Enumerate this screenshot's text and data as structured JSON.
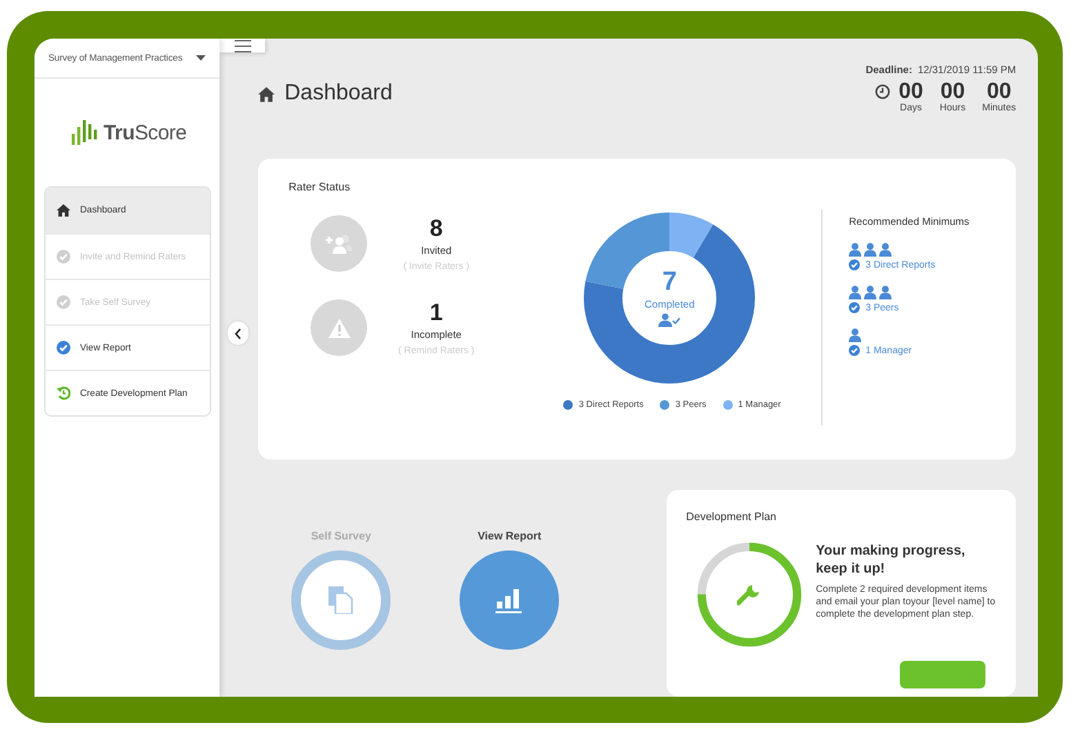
{
  "survey_selector": {
    "label": "Survey of Management Practices"
  },
  "logo": {
    "text": "**Tru**Score"
  },
  "sidebar": {
    "items": [
      {
        "label": "Dashboard",
        "kind": "home",
        "selected": true,
        "disabled": false
      },
      {
        "label": "Invite and Remind Raters",
        "kind": "check",
        "selected": false,
        "disabled": true
      },
      {
        "label": "Take Self Survey",
        "kind": "check",
        "selected": false,
        "disabled": true
      },
      {
        "label": "View Report",
        "kind": "check",
        "selected": false,
        "disabled": false
      },
      {
        "label": "Create Development Plan",
        "kind": "plan",
        "selected": false,
        "disabled": false
      }
    ]
  },
  "page": {
    "title": "Dashboard"
  },
  "deadline": {
    "label": "Deadline:",
    "value": "12/31/2019 11:59 PM",
    "units": [
      {
        "value": "00",
        "label": "Days"
      },
      {
        "value": "00",
        "label": "Hours"
      },
      {
        "value": "00",
        "label": "Minutes"
      }
    ]
  },
  "rater_status": {
    "title": "Rater Status",
    "stats": [
      {
        "kind": "invite",
        "count": "8",
        "label": "Invited",
        "link": "( Invite Raters )",
        "disabled": true
      },
      {
        "kind": "warning",
        "count": "1",
        "label": "Incomplete",
        "link": "( Remind Raters )",
        "disabled": true
      }
    ],
    "completed": {
      "count": "7",
      "label": "Completed"
    },
    "legend": [
      {
        "label": "3 Direct Reports",
        "color": "#3c78c6"
      },
      {
        "label": "3 Peers",
        "color": "#5596d6"
      },
      {
        "label": "1 Manager",
        "color": "#7eb2f2"
      }
    ],
    "recommended": {
      "title": "Recommended Minimums",
      "groups": [
        {
          "kind": "direct_reports",
          "label": "3 Direct Reports"
        },
        {
          "kind": "peers",
          "label": "3 Peers"
        },
        {
          "kind": "manager",
          "label": "1 Manager"
        }
      ]
    }
  },
  "steps": [
    {
      "title": "Self Survey",
      "kind": "survey",
      "disabled": true
    },
    {
      "title": "View Report",
      "kind": "report",
      "disabled": false
    }
  ],
  "development_plan": {
    "title": "Development Plan",
    "level": 0.75,
    "heading": "Your making progress, keep it up!",
    "text": "Complete 2 required development items and email your plan toyour [level name] to complete the development plan step."
  }
}
